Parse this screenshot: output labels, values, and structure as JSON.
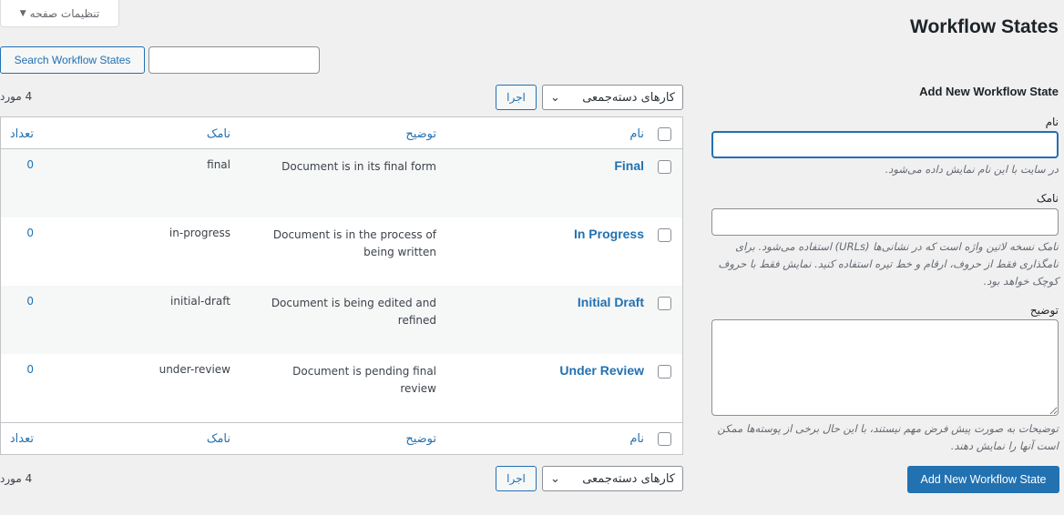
{
  "header": {
    "title": "Workflow States",
    "screen_options": "تنظیمات صفحه"
  },
  "search": {
    "button": "Search Workflow States",
    "value": ""
  },
  "list": {
    "item_count": "4 مورد",
    "bulk_actions": "کارهای دسته‌جمعی",
    "apply": "اجرا",
    "columns": {
      "name": "نام",
      "description": "توضیح",
      "slug": "نامک",
      "count": "تعداد"
    },
    "rows": [
      {
        "name": "Final",
        "description": "Document is in its final form",
        "slug": "final",
        "count": "0"
      },
      {
        "name": "In Progress",
        "description": "Document is in the process of being written",
        "slug": "in-progress",
        "count": "0"
      },
      {
        "name": "Initial Draft",
        "description": "Document is being edited and refined",
        "slug": "initial-draft",
        "count": "0"
      },
      {
        "name": "Under Review",
        "description": "Document is pending final review",
        "slug": "under-review",
        "count": "0"
      }
    ]
  },
  "form": {
    "heading": "Add New Workflow State",
    "name_label": "نام",
    "name_help": "در سایت با این نام نمایش داده می‌شود.",
    "slug_label": "نامک",
    "slug_help": "نامک نسخه لاتین واژه است که در نشانی‌ها (URLs) استفاده می‌شود. برای نامگذاری فقط از حروف، ارقام و خط تیره استفاده کنید. نمایش فقط با حروف کوچک خواهد بود.",
    "desc_label": "توضیح",
    "desc_help": "توضیحات به صورت پیش فرض مهم نیستند، با این حال برخی از پوسته‌ها ممکن است آنها را نمایش دهند.",
    "submit": "Add New Workflow State"
  },
  "colors": {
    "accent": "#2271b1",
    "background": "#f0f0f1"
  }
}
